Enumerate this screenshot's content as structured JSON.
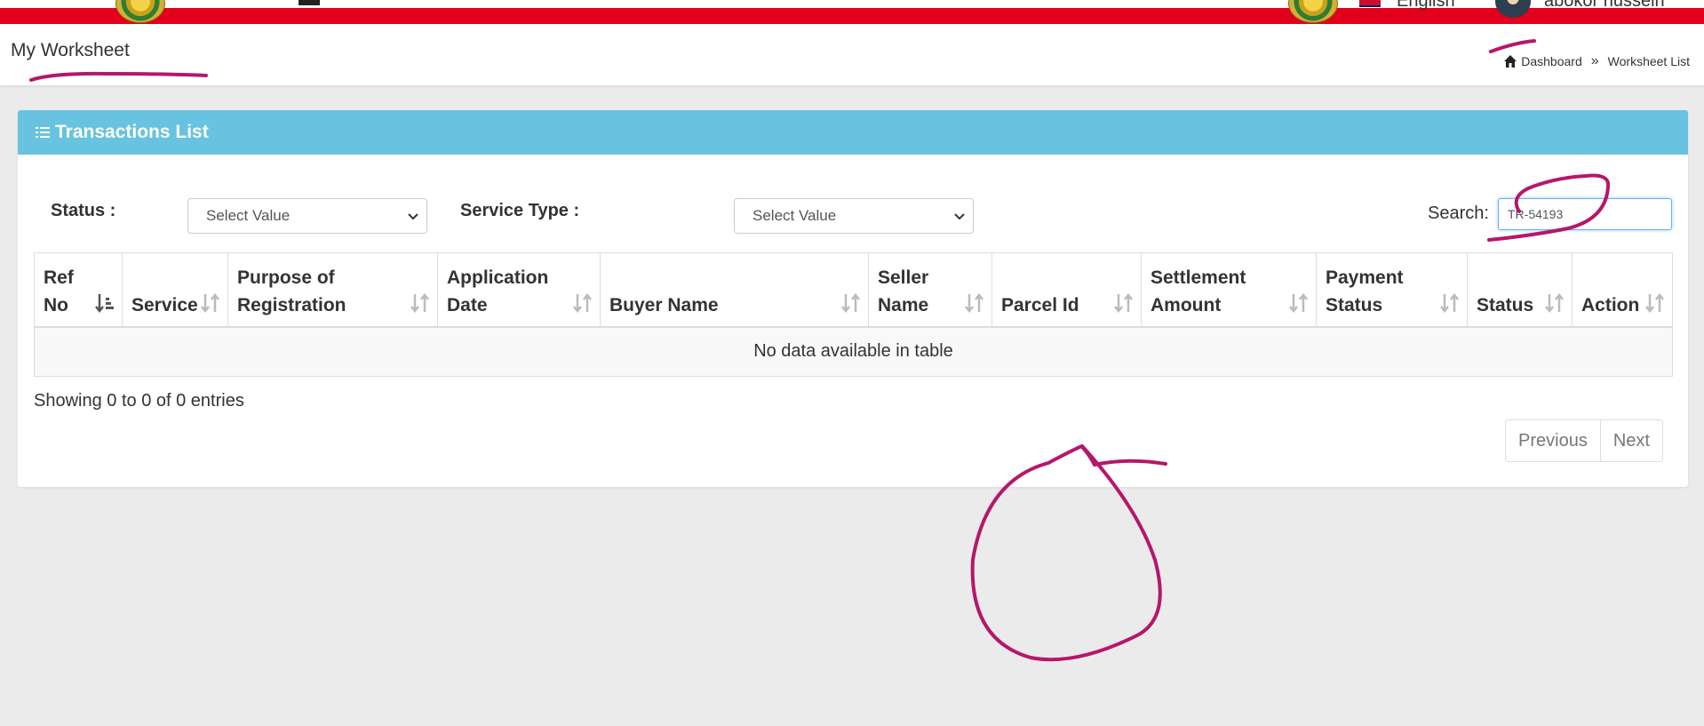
{
  "topbar": {
    "language": "English",
    "username": "abokor hussein"
  },
  "header": {
    "page_title": "My Worksheet",
    "breadcrumb": {
      "home": "Dashboard",
      "separator": "»",
      "current": "Worksheet List"
    }
  },
  "card": {
    "title": "Transactions List",
    "filters": {
      "status_label": "Status :",
      "status_value": "Select Value",
      "service_type_label": "Service Type :",
      "service_type_value": "Select Value"
    },
    "search": {
      "label": "Search:",
      "value": "TR-54193"
    },
    "table": {
      "columns": [
        {
          "line1": "Ref",
          "line2": "No"
        },
        {
          "line1": "",
          "line2": "Service"
        },
        {
          "line1": "Purpose of",
          "line2": "Registration"
        },
        {
          "line1": "Application",
          "line2": "Date"
        },
        {
          "line1": "",
          "line2": "Buyer Name"
        },
        {
          "line1": "Seller",
          "line2": "Name"
        },
        {
          "line1": "",
          "line2": "Parcel Id"
        },
        {
          "line1": "Settlement",
          "line2": "Amount"
        },
        {
          "line1": "Payment",
          "line2": "Status"
        },
        {
          "line1": "",
          "line2": "Status"
        },
        {
          "line1": "",
          "line2": "Action"
        }
      ],
      "empty_message": "No data available in table"
    },
    "info": "Showing 0 to 0 of 0 entries",
    "pagination": {
      "previous": "Previous",
      "next": "Next"
    }
  },
  "colors": {
    "red_bar": "#e3001b",
    "card_header": "#67c3df",
    "annotation": "#b5176b"
  }
}
